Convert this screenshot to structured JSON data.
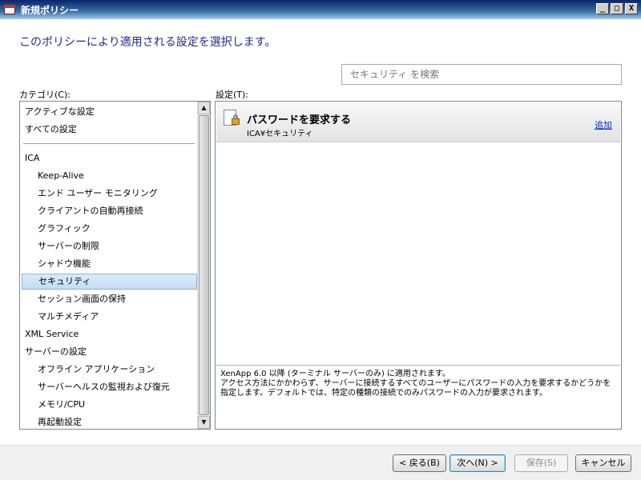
{
  "window": {
    "title": "新規ポリシー",
    "controls": [
      "_",
      "□",
      "X"
    ]
  },
  "heading": "このポリシーにより適用される設定を選択します。",
  "search": {
    "placeholder": "セキュリティ を検索"
  },
  "labels": {
    "category": "カテゴリ(C):",
    "settings": "設定(T):"
  },
  "categories": [
    {
      "label": "アクティブな設定",
      "level": 0
    },
    {
      "label": "すべての設定",
      "level": 0
    },
    {
      "label": "ICA",
      "level": 0
    },
    {
      "label": "Keep-Alive",
      "level": 1
    },
    {
      "label": "エンド ユーザー モニタリング",
      "level": 1
    },
    {
      "label": "クライアントの自動再接続",
      "level": 1
    },
    {
      "label": "グラフィック",
      "level": 1
    },
    {
      "label": "サーバーの制限",
      "level": 1
    },
    {
      "label": "シャドウ機能",
      "level": 1
    },
    {
      "label": "セキュリティ",
      "level": 1,
      "selected": true
    },
    {
      "label": "セッション画面の保持",
      "level": 1
    },
    {
      "label": "マルチメディア",
      "level": 1
    },
    {
      "label": "XML Service",
      "level": 0
    },
    {
      "label": "サーバーの設定",
      "level": 0
    },
    {
      "label": "オフライン アプリケーション",
      "level": 1
    },
    {
      "label": "サーバーヘルスの監視および復元",
      "level": 1
    },
    {
      "label": "メモリ/CPU",
      "level": 1
    },
    {
      "label": "再起動設定",
      "level": 1
    }
  ],
  "setting": {
    "title": "パスワードを要求する",
    "path": "ICA¥セキュリティ",
    "add_link": "追加"
  },
  "description": {
    "line1": "XenApp 6.0 以降 (ターミナル サーバーのみ) に適用されます。",
    "line2": "アクセス方法にかかわらず、サーバーに接続するすべてのユーザーにパスワードの入力を要求するかどうかを",
    "line3": "指定します。デフォルトでは、特定の種類の接続でのみパスワードの入力が要求されます。"
  },
  "buttons": {
    "back": "< 戻る(B)",
    "next": "次へ(N) >",
    "save": "保存(S)",
    "cancel": "キャンセル"
  }
}
